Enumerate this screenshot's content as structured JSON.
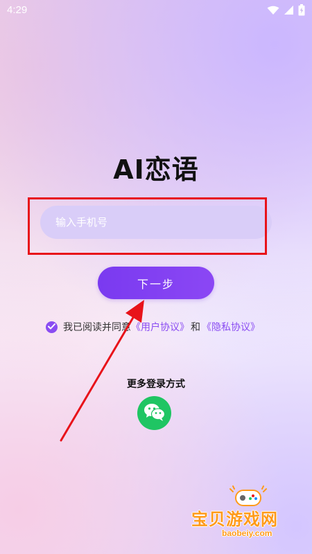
{
  "status_bar": {
    "time": "4:29"
  },
  "app": {
    "title": "AI恋语"
  },
  "login": {
    "phone_placeholder": "输入手机号",
    "next_label": "下一步",
    "agree_prefix": "我已阅读并同意",
    "user_agreement": "《用户协议》",
    "and": "和",
    "privacy_policy": "《隐私协议》",
    "agreed": true,
    "more_login_label": "更多登录方式"
  },
  "watermark": {
    "name": "宝贝游戏网",
    "url": "baobeiy.com"
  },
  "colors": {
    "accent": "#8a4cf2",
    "input_bg": "#d9cdf8",
    "wechat": "#1fc563",
    "annotation": "#e8131a",
    "watermark": "#ff9a1a"
  },
  "icons": {
    "wifi": "wifi-icon",
    "signal": "signal-icon",
    "battery": "battery-icon",
    "check": "check-icon",
    "wechat": "wechat-icon"
  }
}
